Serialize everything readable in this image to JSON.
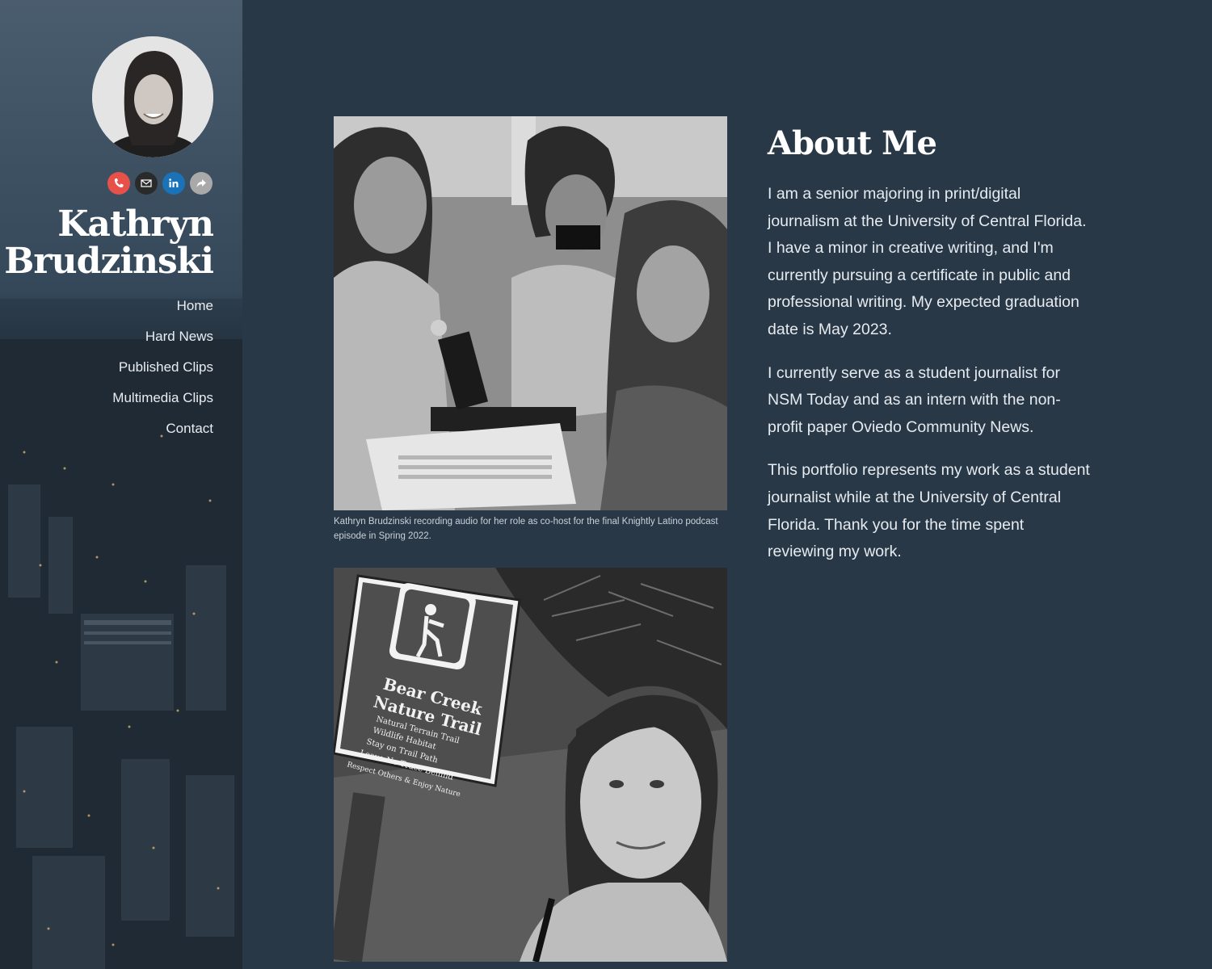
{
  "profile": {
    "first_name": "Kathryn",
    "last_name": "Brudzinski"
  },
  "socials": [
    {
      "name": "phone",
      "icon": "phone-icon",
      "color": "#e8504a"
    },
    {
      "name": "email",
      "icon": "email-icon",
      "color": "#2a2a2a"
    },
    {
      "name": "linkedin",
      "icon": "linkedin-icon",
      "color": "#1a73b8"
    },
    {
      "name": "share",
      "icon": "share-icon",
      "color": "#a9a9a9"
    }
  ],
  "nav": {
    "items": [
      {
        "label": "Home"
      },
      {
        "label": "Hard News"
      },
      {
        "label": "Published Clips"
      },
      {
        "label": "Multimedia Clips"
      },
      {
        "label": "Contact"
      }
    ]
  },
  "photos": {
    "first_caption": "Kathryn Brudzinski recording audio for her role as co-host for the final Knightly Latino podcast episode in Spring 2022.",
    "sign": {
      "line1": "Bear Creek",
      "line2": "Nature Trail",
      "line3": "Natural Terrain Trail",
      "line4": "Wildlife Habitat",
      "line5": "Stay on Trail Path",
      "line6": "Leave No Trace Behind",
      "line7": "Respect Others & Enjoy Nature"
    }
  },
  "about": {
    "heading": "About Me",
    "paragraphs": [
      "I am a senior majoring in print/digital journalism at the University of Central Florida. I have a minor in creative writing, and I'm currently pursuing a certificate in public and professional writing. My expected graduation date is May 2023.",
      "I currently serve as a student journalist for NSM Today and as an intern with the non-profit paper Oviedo Community News.",
      "This portfolio represents my work as a student journalist while at the University of Central Florida. Thank you for the time spent reviewing my work."
    ]
  },
  "colors": {
    "page_background": "#293847",
    "heading_text": "#ffffff",
    "body_text": "#e6ebf0"
  }
}
